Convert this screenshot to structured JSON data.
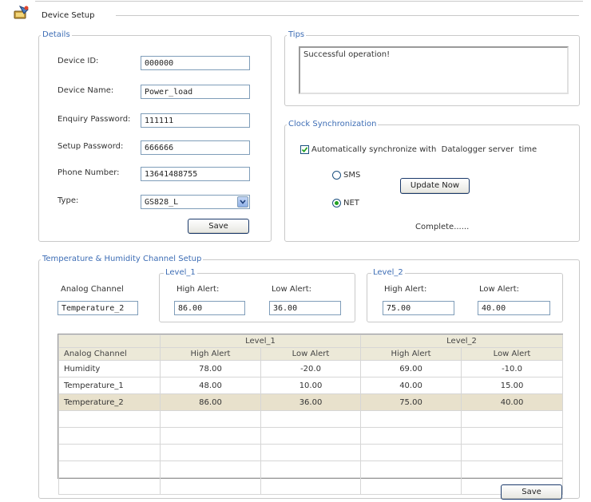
{
  "header": {
    "title": "Device Setup",
    "icon": "device-setup-icon"
  },
  "details": {
    "legend": "Details",
    "device_id": {
      "label": "Device ID:",
      "value": "000000"
    },
    "device_name": {
      "label": "Device Name:",
      "value": "Power_load"
    },
    "enquiry_password": {
      "label": "Enquiry Password:",
      "value": "111111"
    },
    "setup_password": {
      "label": "Setup Password:",
      "value": "666666"
    },
    "phone_number": {
      "label": "Phone Number:",
      "value": "13641488755"
    },
    "type": {
      "label": "Type:",
      "value": "GS828_L"
    },
    "save_label": "Save"
  },
  "tips": {
    "legend": "Tips",
    "message": "Successful operation!"
  },
  "clock": {
    "legend": "Clock Synchronization",
    "auto_sync_label": "Automatically synchronize with  Datalogger server  time",
    "auto_sync_checked": true,
    "sms_label": "SMS",
    "net_label": "NET",
    "selected": "NET",
    "update_label": "Update Now",
    "status": "Complete......"
  },
  "channel": {
    "legend": "Temperature & Humidity Channel Setup",
    "analog_label": "Analog Channel",
    "analog_value": "Temperature_2",
    "level1": {
      "legend": "Level_1",
      "high_label": "High Alert:",
      "high_value": "86.00",
      "low_label": "Low Alert:",
      "low_value": "36.00"
    },
    "level2": {
      "legend": "Level_2",
      "high_label": "High Alert:",
      "high_value": "75.00",
      "low_label": "Low Alert:",
      "low_value": "40.00"
    },
    "table": {
      "group_level1": "Level_1",
      "group_level2": "Level_2",
      "headers": [
        "Analog Channel",
        "High Alert",
        "Low Alert",
        "High Alert",
        "Low Alert"
      ],
      "rows": [
        [
          "Humidity",
          "78.00",
          "-20.0",
          "69.00",
          "-10.0"
        ],
        [
          "Temperature_1",
          "48.00",
          "10.00",
          "40.00",
          "15.00"
        ],
        [
          "Temperature_2",
          "86.00",
          "36.00",
          "75.00",
          "40.00"
        ]
      ],
      "selected_row": 2
    },
    "save_label": "Save"
  }
}
